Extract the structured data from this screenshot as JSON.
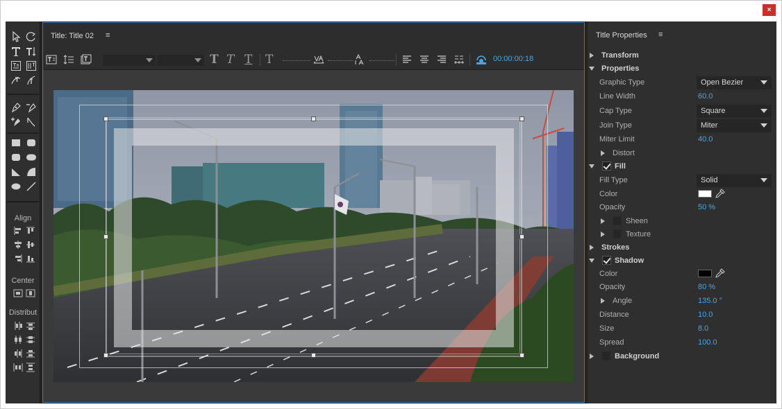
{
  "window": {
    "close_label": "×"
  },
  "tools": {
    "align_label": "Align",
    "center_label": "Center",
    "distribute_label": "Distribut"
  },
  "designer": {
    "title": "Title: Title 02",
    "menu_glyph": "≡",
    "timecode": "00:00:00:18",
    "text_styles": [
      "T",
      "T",
      "T",
      "T"
    ]
  },
  "props": {
    "title": "Title Properties",
    "menu_glyph": "≡",
    "sections": {
      "transform": "Transform",
      "properties": "Properties",
      "fill": "Fill",
      "strokes": "Strokes",
      "shadow": "Shadow",
      "background": "Background"
    },
    "rows": {
      "graphic_type": {
        "label": "Graphic Type",
        "value": "Open Bezier"
      },
      "line_width": {
        "label": "Line Width",
        "value": "60.0"
      },
      "cap_type": {
        "label": "Cap Type",
        "value": "Square"
      },
      "join_type": {
        "label": "Join Type",
        "value": "Miter"
      },
      "miter_limit": {
        "label": "Miter Limit",
        "value": "40.0"
      },
      "distort": {
        "label": "Distort"
      },
      "fill_type": {
        "label": "Fill Type",
        "value": "Solid"
      },
      "fill_color": {
        "label": "Color",
        "swatch": "#ffffff"
      },
      "fill_opacity": {
        "label": "Opacity",
        "value": "50 %"
      },
      "sheen": {
        "label": "Sheen"
      },
      "texture": {
        "label": "Texture"
      },
      "shadow_color": {
        "label": "Color",
        "swatch": "#000000"
      },
      "shadow_opacity": {
        "label": "Opacity",
        "value": "80 %"
      },
      "angle": {
        "label": "Angle",
        "value": "135.0 °"
      },
      "distance": {
        "label": "Distance",
        "value": "10.0"
      },
      "size": {
        "label": "Size",
        "value": "8.0"
      },
      "spread": {
        "label": "Spread",
        "value": "100.0"
      }
    }
  },
  "colors": {
    "accent": "#4fa3e0",
    "selection_border": "#3b79b8",
    "close": "#c9302c"
  }
}
